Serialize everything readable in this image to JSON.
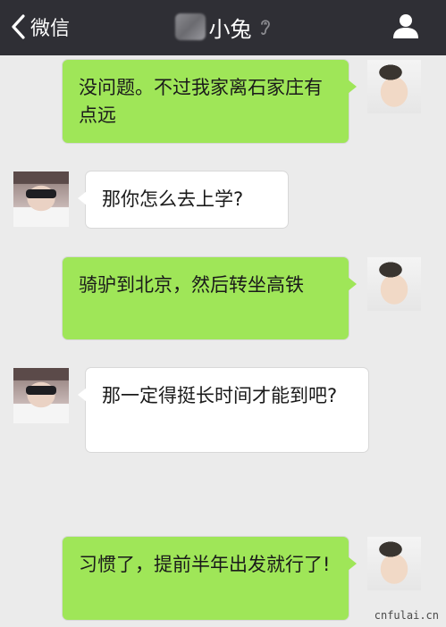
{
  "header": {
    "back_label": "微信",
    "title": "小兔"
  },
  "messages": [
    {
      "sender": "me",
      "text": "没问题。不过我家离石家庄有点远"
    },
    {
      "sender": "her",
      "text": "那你怎么去上学?"
    },
    {
      "sender": "me",
      "text": "骑驴到北京，然后转坐高铁"
    },
    {
      "sender": "her",
      "text": "那一定得挺长时间才能到吧?"
    },
    {
      "sender": "me",
      "text": "习惯了，提前半年出发就行了!"
    }
  ],
  "watermark": "cnfulai.cn",
  "colors": {
    "header_bg": "#2f2f35",
    "chat_bg": "#ebebeb",
    "my_bubble": "#9fe658",
    "their_bubble": "#ffffff"
  },
  "icons": [
    "chevron-left-icon",
    "ear-icon",
    "contact-person-icon"
  ]
}
